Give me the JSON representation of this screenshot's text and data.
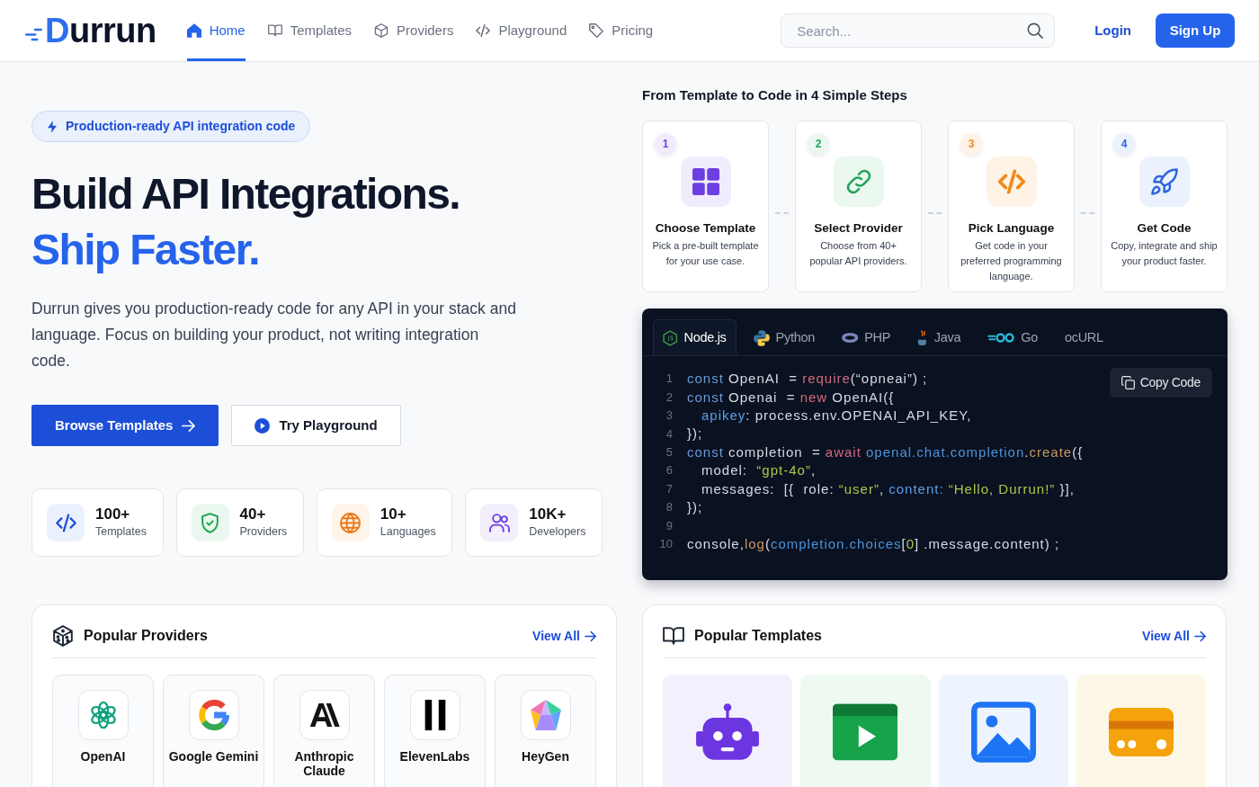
{
  "navbar": {
    "brand": "Durrun",
    "links": [
      {
        "label": "Home",
        "kind": "home",
        "selected": true
      },
      {
        "label": "Templates",
        "kind": "book",
        "selected": false
      },
      {
        "label": "Providers",
        "kind": "cube",
        "selected": false
      },
      {
        "label": "Playground",
        "kind": "code",
        "selected": false
      },
      {
        "label": "Pricing",
        "kind": "tag",
        "selected": false
      }
    ],
    "search": {
      "placeholder": "Search..."
    },
    "login": "Login",
    "signup": "Sign Up"
  },
  "hero": {
    "badge": "Production-ready API integration code",
    "title": "Build API Integrations.",
    "title_accent": "Ship Faster.",
    "description": "Durrun gives you production-ready code for any API in your stack and language. Focus on building your product, not writing integration code.",
    "buttons": [
      {
        "label": "Browse Templates",
        "kind": "primary"
      },
      {
        "label": "Try Playground",
        "kind": "secondary"
      }
    ],
    "stats": [
      {
        "value": "100+",
        "label": "Templates",
        "kind": "code"
      },
      {
        "value": "40+",
        "label": "Providers",
        "kind": "shield"
      },
      {
        "value": "10+",
        "label": "Languages",
        "kind": "globe"
      },
      {
        "value": "10K+",
        "label": "Developers",
        "kind": "users"
      }
    ]
  },
  "steps": {
    "title": "From Template to Code in 4 Simple Steps",
    "items": [
      {
        "number": "1",
        "title": "Choose Template",
        "description": "Pick a pre-built template for your use case.",
        "kind": "grid"
      },
      {
        "number": "2",
        "title": "Select Provider",
        "description": "Choose from 40+ popular API providers.",
        "kind": "link"
      },
      {
        "number": "3",
        "title": "Pick Language",
        "description": "Get code in your preferred programming language.",
        "kind": "code"
      },
      {
        "number": "4",
        "title": "Get Code",
        "description": "Copy, integrate and ship your product faster.",
        "kind": "rocket"
      }
    ]
  },
  "code_panel": {
    "tabs": [
      {
        "label": "Node.js",
        "kind": "node",
        "selected": true
      },
      {
        "label": "Python",
        "kind": "python",
        "selected": false
      },
      {
        "label": "PHP",
        "kind": "php",
        "selected": false
      },
      {
        "label": "Java",
        "kind": "java",
        "selected": false
      },
      {
        "label": "Go",
        "kind": "go",
        "selected": false
      },
      {
        "label": "ocURL",
        "kind": "curl",
        "selected": false
      }
    ],
    "copy_button": "Copy Code",
    "lines": [
      {
        "number": "1",
        "indented": false,
        "tokens": [
          {
            "kind": "keyword",
            "text": "const"
          },
          {
            "kind": "plain",
            "text": " OpenAI  = "
          },
          {
            "kind": "builtin",
            "text": "require"
          },
          {
            "kind": "plain",
            "text": "(“opneai”) ;"
          }
        ]
      },
      {
        "number": "2",
        "indented": false,
        "tokens": [
          {
            "kind": "keyword",
            "text": "const"
          },
          {
            "kind": "plain",
            "text": " Openai  = "
          },
          {
            "kind": "builtin",
            "text": "new"
          },
          {
            "kind": "plain",
            "text": " OpenAI({"
          }
        ]
      },
      {
        "number": "3",
        "indented": true,
        "tokens": [
          {
            "kind": "property",
            "text": "apikey"
          },
          {
            "kind": "plain",
            "text": ": process.env.OPENAI_API_KEY,"
          }
        ]
      },
      {
        "number": "4",
        "indented": false,
        "tokens": [
          {
            "kind": "plain",
            "text": "});"
          }
        ]
      },
      {
        "number": "5",
        "indented": false,
        "tokens": [
          {
            "kind": "keyword",
            "text": "const"
          },
          {
            "kind": "plain",
            "text": " completion  = "
          },
          {
            "kind": "builtin",
            "text": "await"
          },
          {
            "kind": "member",
            "text": " openal.chat.completion"
          },
          {
            "kind": "plain",
            "text": "."
          },
          {
            "kind": "method",
            "text": "create"
          },
          {
            "kind": "plain",
            "text": "({"
          }
        ]
      },
      {
        "number": "6",
        "indented": true,
        "tokens": [
          {
            "kind": "plain",
            "text": "model:  "
          },
          {
            "kind": "string",
            "text": "“gpt-4o”"
          },
          {
            "kind": "plain",
            "text": ","
          }
        ]
      },
      {
        "number": "7",
        "indented": true,
        "tokens": [
          {
            "kind": "plain",
            "text": "messages:  [{  role: "
          },
          {
            "kind": "string",
            "text": "“user”"
          },
          {
            "kind": "plain",
            "text": ", "
          },
          {
            "kind": "property",
            "text": "content: "
          },
          {
            "kind": "string",
            "text": "“Hello, Durrun!”"
          },
          {
            "kind": "plain",
            "text": " }],"
          }
        ]
      },
      {
        "number": "8",
        "indented": false,
        "tokens": [
          {
            "kind": "plain",
            "text": "});"
          }
        ]
      },
      {
        "number": "9"
      },
      {
        "number": "10",
        "indented": false,
        "tokens": [
          {
            "kind": "plain",
            "text": "console,"
          },
          {
            "kind": "method",
            "text": "log"
          },
          {
            "kind": "plain",
            "text": "("
          },
          {
            "kind": "member",
            "text": "completion.choices"
          },
          {
            "kind": "plain",
            "text": "["
          },
          {
            "kind": "string",
            "text": "0"
          },
          {
            "kind": "plain",
            "text": "] .message.content) ;"
          }
        ]
      }
    ]
  },
  "providers_panel": {
    "title": "Popular Providers",
    "view_all": "View All",
    "items": [
      {
        "name": "OpenAI",
        "kind": "knot"
      },
      {
        "name": "Google Gemini",
        "kind": "g"
      },
      {
        "name": "Anthropic Claude",
        "kind": "slash"
      },
      {
        "name": "ElevenLabs",
        "kind": "bars"
      },
      {
        "name": "HeyGen",
        "kind": "gem"
      }
    ]
  },
  "templates_panel": {
    "title": "Popular Templates",
    "view_all": "View All",
    "items": [
      {
        "kind": "robot"
      },
      {
        "kind": "video"
      },
      {
        "kind": "image"
      },
      {
        "kind": "card"
      }
    ]
  }
}
